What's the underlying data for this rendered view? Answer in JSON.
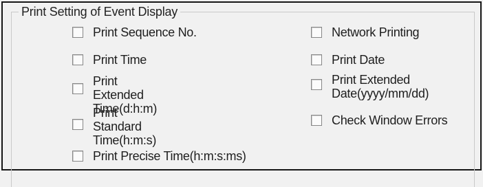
{
  "group": {
    "title": "Print Setting of Event Display"
  },
  "options": {
    "print_sequence_no": {
      "label": "Print Sequence No.",
      "checked": false
    },
    "print_time": {
      "label": "Print Time",
      "checked": false
    },
    "print_extended_time": {
      "label": "Print Extended\nTime(d:h:m)",
      "checked": false
    },
    "print_standard_time": {
      "label": "Print Standard\nTime(h:m:s)",
      "checked": false
    },
    "print_precise_time": {
      "label": "Print Precise Time(h:m:s:ms)",
      "checked": false
    },
    "network_printing": {
      "label": "Network Printing",
      "checked": false
    },
    "print_date": {
      "label": "Print Date",
      "checked": false
    },
    "print_extended_date": {
      "label": "Print Extended\nDate(yyyy/mm/dd)",
      "checked": false
    },
    "check_window_errors": {
      "label": "Check Window Errors",
      "checked": false
    }
  }
}
